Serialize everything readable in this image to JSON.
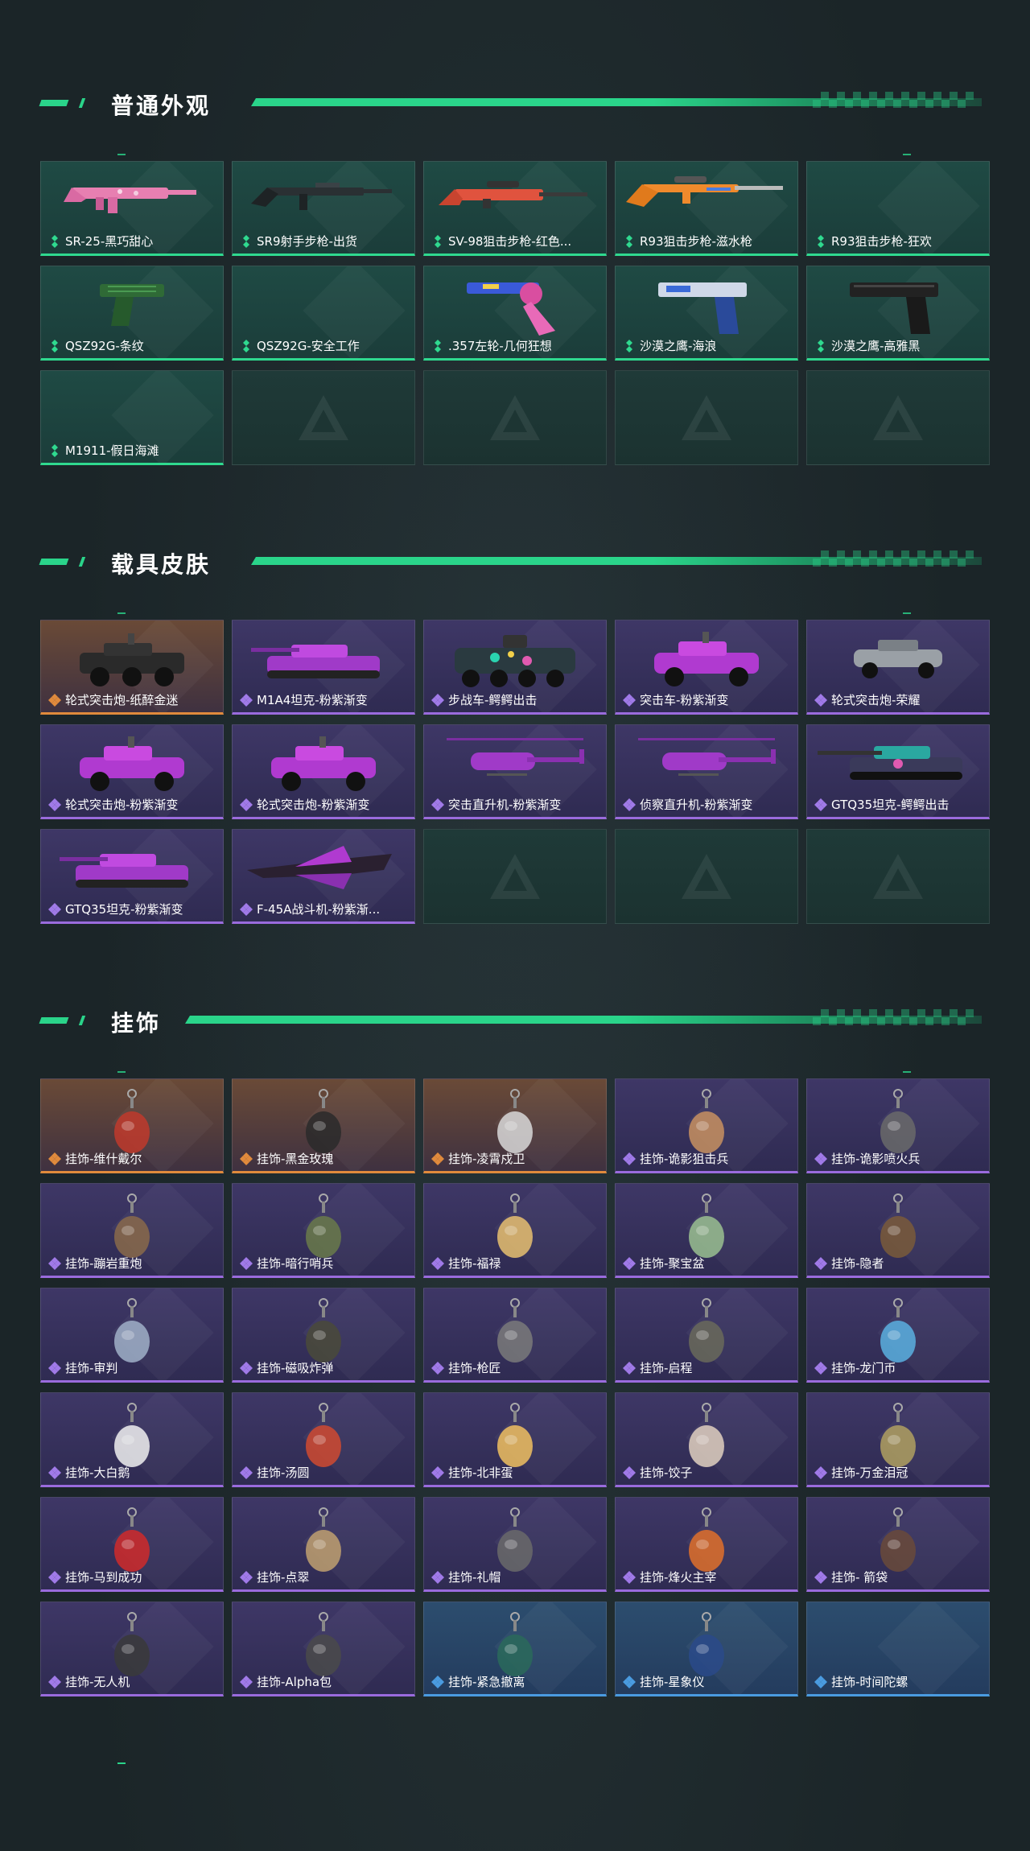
{
  "sections": [
    {
      "title": "普通外观",
      "items": [
        {
          "label": "SR-25-黑巧甜心",
          "rarity": "green",
          "icon": "rifle-pink"
        },
        {
          "label": "SR9射手步枪-出货",
          "rarity": "green",
          "icon": "rifle-black"
        },
        {
          "label": "SV-98狙击步枪-红色...",
          "rarity": "green",
          "icon": "sniper-red"
        },
        {
          "label": "R93狙击步枪-滋水枪",
          "rarity": "green",
          "icon": "sniper-orange"
        },
        {
          "label": "R93狙击步枪-狂欢",
          "rarity": "green",
          "icon": ""
        },
        {
          "label": "QSZ92G-条纹",
          "rarity": "green",
          "icon": "pistol-green"
        },
        {
          "label": "QSZ92G-安全工作",
          "rarity": "green",
          "icon": ""
        },
        {
          "label": ".357左轮-几何狂想",
          "rarity": "green",
          "icon": "revolver"
        },
        {
          "label": "沙漠之鹰-海浪",
          "rarity": "green",
          "icon": "pistol-blue"
        },
        {
          "label": "沙漠之鹰-高雅黑",
          "rarity": "green",
          "icon": "pistol-black"
        },
        {
          "label": "M1911-假日海滩",
          "rarity": "green",
          "icon": ""
        },
        {
          "label": "",
          "rarity": "empty"
        },
        {
          "label": "",
          "rarity": "empty"
        },
        {
          "label": "",
          "rarity": "empty"
        },
        {
          "label": "",
          "rarity": "empty"
        }
      ]
    },
    {
      "title": "载具皮肤",
      "items": [
        {
          "label": "轮式突击炮-纸醉金迷",
          "rarity": "orange",
          "icon": "vehicle-black"
        },
        {
          "label": "M1A4坦克-粉紫渐变",
          "rarity": "purple",
          "icon": "tank-purple"
        },
        {
          "label": "步战车-鳄鳄出击",
          "rarity": "purple",
          "icon": "apc-teal"
        },
        {
          "label": "突击车-粉紫渐变",
          "rarity": "purple",
          "icon": "vehicle-purple"
        },
        {
          "label": "轮式突击炮-荣耀",
          "rarity": "purple",
          "icon": "vehicle-grey"
        },
        {
          "label": "轮式突击炮-粉紫渐变",
          "rarity": "purple",
          "icon": "vehicle-purple"
        },
        {
          "label": "轮式突击炮-粉紫渐变",
          "rarity": "purple",
          "icon": "vehicle-purple"
        },
        {
          "label": "突击直升机-粉紫渐变",
          "rarity": "purple",
          "icon": "helicopter"
        },
        {
          "label": "侦察直升机-粉紫渐变",
          "rarity": "purple",
          "icon": "helicopter"
        },
        {
          "label": "GTQ35坦克-鳄鳄出击",
          "rarity": "purple",
          "icon": "tank-teal"
        },
        {
          "label": "GTQ35坦克-粉紫渐变",
          "rarity": "purple",
          "icon": "tank-purple"
        },
        {
          "label": "F-45A战斗机-粉紫渐...",
          "rarity": "purple",
          "icon": "jet"
        },
        {
          "label": "",
          "rarity": "empty"
        },
        {
          "label": "",
          "rarity": "empty"
        },
        {
          "label": "",
          "rarity": "empty"
        }
      ]
    },
    {
      "title": "挂饰",
      "items": [
        {
          "label": "挂饰-维什戴尔",
          "rarity": "orange",
          "icon": "charm"
        },
        {
          "label": "挂饰-黑金玫瑰",
          "rarity": "orange",
          "icon": "charm"
        },
        {
          "label": "挂饰-凌霄戍卫",
          "rarity": "orange",
          "icon": "charm"
        },
        {
          "label": "挂饰-诡影狙击兵",
          "rarity": "purple",
          "icon": "charm"
        },
        {
          "label": "挂饰-诡影喷火兵",
          "rarity": "purple",
          "icon": "charm"
        },
        {
          "label": "挂饰-蹦岩重炮",
          "rarity": "purple",
          "icon": "charm"
        },
        {
          "label": "挂饰-暗行哨兵",
          "rarity": "purple",
          "icon": "charm"
        },
        {
          "label": "挂饰-福禄",
          "rarity": "purple",
          "icon": "charm"
        },
        {
          "label": "挂饰-聚宝盆",
          "rarity": "purple",
          "icon": "charm"
        },
        {
          "label": "挂饰-隐者",
          "rarity": "purple",
          "icon": "charm"
        },
        {
          "label": "挂饰-审判",
          "rarity": "purple",
          "icon": "charm"
        },
        {
          "label": "挂饰-磁吸炸弹",
          "rarity": "purple",
          "icon": "charm"
        },
        {
          "label": "挂饰-枪匠",
          "rarity": "purple",
          "icon": "charm"
        },
        {
          "label": "挂饰-启程",
          "rarity": "purple",
          "icon": "charm"
        },
        {
          "label": "挂饰-龙门币",
          "rarity": "purple",
          "icon": "charm"
        },
        {
          "label": "挂饰-大白鹅",
          "rarity": "purple",
          "icon": "charm"
        },
        {
          "label": "挂饰-汤圆",
          "rarity": "purple",
          "icon": "charm"
        },
        {
          "label": "挂饰-北非蛋",
          "rarity": "purple",
          "icon": "charm"
        },
        {
          "label": "挂饰-饺子",
          "rarity": "purple",
          "icon": "charm"
        },
        {
          "label": "挂饰-万金泪冠",
          "rarity": "purple",
          "icon": "charm"
        },
        {
          "label": "挂饰-马到成功",
          "rarity": "purple",
          "icon": "charm"
        },
        {
          "label": "挂饰-点翠",
          "rarity": "purple",
          "icon": "charm"
        },
        {
          "label": "挂饰-礼帽",
          "rarity": "purple",
          "icon": "charm"
        },
        {
          "label": "挂饰-烽火主宰",
          "rarity": "purple",
          "icon": "charm"
        },
        {
          "label": "挂饰- 箭袋",
          "rarity": "purple",
          "icon": "charm"
        },
        {
          "label": "挂饰-无人机",
          "rarity": "purple",
          "icon": "charm"
        },
        {
          "label": "挂饰-Alpha包",
          "rarity": "purple",
          "icon": "charm"
        },
        {
          "label": "挂饰-紧急撤离",
          "rarity": "blue",
          "icon": "charm"
        },
        {
          "label": "挂饰-星象仪",
          "rarity": "blue",
          "icon": "charm"
        },
        {
          "label": "挂饰-时间陀螺",
          "rarity": "blue",
          "icon": ""
        }
      ]
    }
  ],
  "colors": {
    "accent": "#2ad48a",
    "green_rarity": "#2fd98f",
    "purple_rarity": "#9a6bdd",
    "orange_rarity": "#e08a3c",
    "blue_rarity": "#4a9be0"
  }
}
